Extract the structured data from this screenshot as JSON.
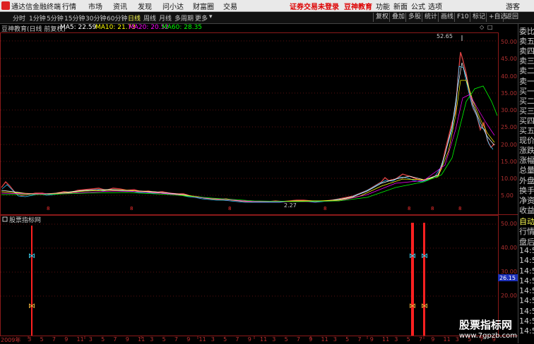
{
  "menubar": {
    "app_title": "通达信金融终端",
    "items": [
      "行情",
      "市场",
      "资讯",
      "发现",
      "问小达",
      "财富圈",
      "交易"
    ],
    "alert": "证券交易未登录",
    "partner": "豆神教育",
    "right_items": [
      "功能",
      "新面",
      "公式",
      "选项"
    ],
    "user": "游客"
  },
  "periodbar": {
    "periods": [
      "分时",
      "1分钟",
      "5分钟",
      "15分钟",
      "30分钟",
      "60分钟",
      "日线",
      "周线",
      "月线",
      "多周期",
      "更多"
    ],
    "active": "日线",
    "tools": [
      "复权",
      "叠加",
      "多股",
      "统计",
      "画线",
      "F10",
      "标记",
      "+自选",
      "返回"
    ]
  },
  "marow": {
    "stock": "豆神教育(日线 前复权)",
    "ma5": "MA5: 22.59",
    "ma10": "MA10: 21.73",
    "ma20": "MA20: 20.52",
    "ma60": "MA60: 28.35"
  },
  "main_chart": {
    "high_label": "52.65",
    "low_label": "2.27",
    "y_ticks": [
      "50.00",
      "45.00",
      "40.00",
      "35.00",
      "30.00",
      "25.00",
      "20.00",
      "15.00",
      "10.00",
      "5.00"
    ]
  },
  "indicator": {
    "title": "股票指标网",
    "y_ticks": [
      "50.00",
      "40.00",
      "30.00",
      "20.00"
    ],
    "current_value": "26.15"
  },
  "x_axis": {
    "labels": [
      "2009年",
      "3",
      "5",
      "7",
      "9",
      "11",
      "3",
      "5",
      "7",
      "9",
      "11",
      "3",
      "5",
      "7",
      "9",
      "11",
      "3",
      "5",
      "7",
      "9",
      "11",
      "3",
      "5",
      "7",
      "9",
      "11",
      "3",
      "5",
      "7",
      "9",
      "11",
      "3",
      "5",
      "7",
      "9",
      "11",
      "3",
      "5",
      "7",
      "9"
    ]
  },
  "sidebar": {
    "items": [
      "委比",
      "卖五",
      "卖四",
      "卖三",
      "卖二",
      "卖一",
      "买一",
      "买二",
      "买三",
      "买四",
      "买五",
      "现价",
      "涨跌",
      "涨幅",
      "总量",
      "外盘",
      "换手",
      "净资",
      "收益"
    ],
    "lower_items": [
      "自动",
      "行情",
      "盘后",
      "14:5",
      "14:5",
      "14:5",
      "14:5",
      "14:5",
      "14:5",
      "14:5",
      "14:5",
      "14:5"
    ]
  },
  "watermark": {
    "title": "股票指标网",
    "url": "www.7gpzb.com"
  },
  "colors": {
    "accent": "#ff3030",
    "ma5": "#ffffff",
    "ma10": "#ffff00",
    "ma20": "#ff00ff",
    "ma60": "#00ff00"
  }
}
